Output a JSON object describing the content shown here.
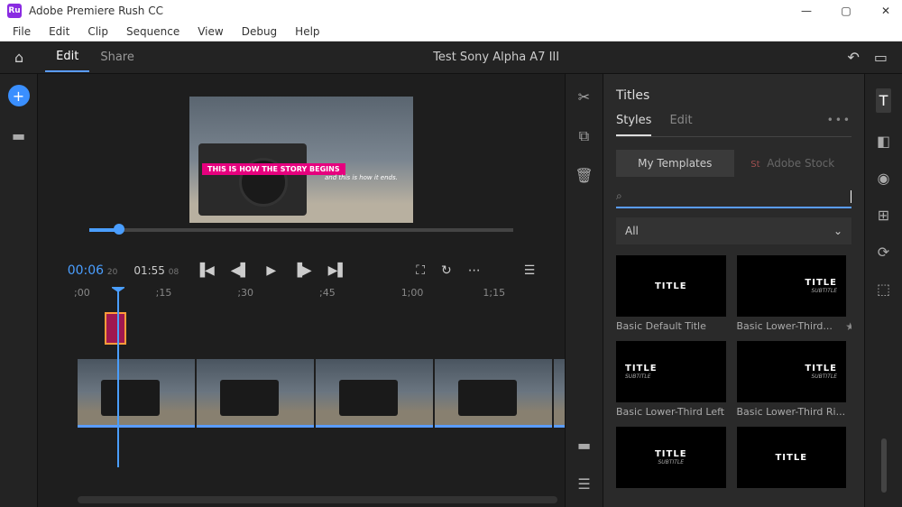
{
  "titlebar": {
    "app_name": "Adobe Premiere Rush CC",
    "icon_text": "Ru"
  },
  "menubar": {
    "items": [
      "File",
      "Edit",
      "Clip",
      "Sequence",
      "View",
      "Debug",
      "Help"
    ]
  },
  "topbar": {
    "tabs": {
      "edit": "Edit",
      "share": "Share"
    },
    "project_title": "Test Sony Alpha A7 III"
  },
  "preview": {
    "banner_text": "THIS IS HOW THE STORY BEGINS",
    "sub_text": "and this is how it ends."
  },
  "controls": {
    "current": "00:06",
    "current_frames": "20",
    "total": "01:55",
    "total_frames": "08"
  },
  "ruler": {
    "ticks": [
      ";00",
      ";15",
      ";30",
      ";45",
      "1;00",
      "1;15"
    ]
  },
  "panel": {
    "title": "Titles",
    "tabs": {
      "styles": "Styles",
      "edit": "Edit"
    },
    "sources": {
      "my": "My Templates",
      "stock": "Adobe Stock"
    },
    "search_placeholder": "",
    "filter": "All",
    "templates": [
      {
        "label": "Basic Default Title",
        "title": "TITLE",
        "sub": "",
        "align": "center"
      },
      {
        "label": "Basic Lower-Third...",
        "title": "TITLE",
        "sub": "SUBTITLE",
        "align": "right",
        "star": true
      },
      {
        "label": "Basic Lower-Third Left",
        "title": "TITLE",
        "sub": "SUBTITLE",
        "align": "left"
      },
      {
        "label": "Basic Lower-Third Ri...",
        "title": "TITLE",
        "sub": "SUBTITLE",
        "align": "right"
      },
      {
        "label": "",
        "title": "TITLE",
        "sub": "SUBTITLE",
        "align": "center"
      },
      {
        "label": "",
        "title": "TITLE",
        "sub": "",
        "align": "center"
      }
    ]
  },
  "clip_widths": [
    130,
    130,
    130,
    130,
    90
  ]
}
